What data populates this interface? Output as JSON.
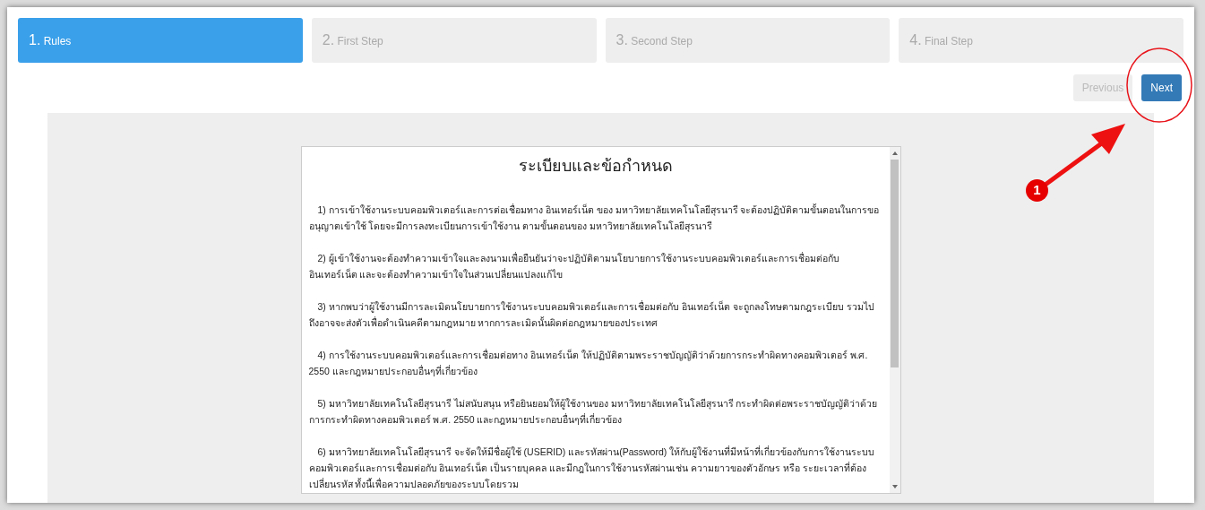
{
  "steps": [
    {
      "number": "1.",
      "label": "Rules",
      "selected": true
    },
    {
      "number": "2.",
      "label": "First Step",
      "selected": false
    },
    {
      "number": "3.",
      "label": "Second Step",
      "selected": false
    },
    {
      "number": "4.",
      "label": "Final Step",
      "selected": false
    }
  ],
  "buttons": [
    {
      "label": "Previous",
      "disabled": true
    },
    {
      "label": "Next",
      "disabled": false
    }
  ],
  "document": {
    "title": "ระเบียบและข้อกำหนด",
    "paragraphs": [
      "1) การเข้าใช้งานระบบคอมพิวเตอร์และการต่อเชื่อมทาง อินเทอร์เน็ต ของ มหาวิทยาลัยเทคโนโลยีสุรนารี จะต้องปฏิบัติตามขั้นตอนในการขออนุญาตเข้าใช้ โดยจะมีการลงทะเบียนการเข้าใช้งาน ตามขั้นตอนของ มหาวิทยาลัยเทคโนโลยีสุรนารี",
      "2) ผู้เข้าใช้งานจะต้องทำความเข้าใจและลงนามเพื่อยืนยันว่าจะปฏิบัติตามนโยบายการใช้งานระบบคอมพิวเตอร์และการเชื่อมต่อกับ อินเทอร์เน็ต และจะต้องทำความเข้าใจในส่วนเปลี่ยนแปลงแก้ไข",
      "3) หากพบว่าผู้ใช้งานมีการละเมิดนโยบายการใช้งานระบบคอมพิวเตอร์และการเชื่อมต่อกับ อินเทอร์เน็ต จะถูกลงโทษตามกฎระเบียบ รวมไปถึงอาจจะส่งตัวเพื่อดำเนินคดีตามกฎหมาย หากการละเมิดนั้นผิดต่อกฎหมายของประเทศ",
      "4) การใช้งานระบบคอมพิวเตอร์และการเชื่อมต่อทาง อินเทอร์เน็ต ให้ปฏิบัติตามพระราชบัญญัติว่าด้วยการกระทำผิดทางคอมพิวเตอร์ พ.ศ. 2550 และกฎหมายประกอบอื่นๆที่เกี่ยวข้อง",
      "5) มหาวิทยาลัยเทคโนโลยีสุรนารี ไม่สนับสนุน หรือยินยอมให้ผู้ใช้งานของ มหาวิทยาลัยเทคโนโลยีสุรนารี กระทำผิดต่อพระราชบัญญัติว่าด้วยการกระทำผิดทางคอมพิวเตอร์ พ.ศ. 2550 และกฎหมายประกอบอื่นๆที่เกี่ยวข้อง",
      "6) มหาวิทยาลัยเทคโนโลยีสุรนารี จะจัดให้มีชื่อผู้ใช้ (USERID) และรหัสผ่าน(Password) ให้กับผู้ใช้งานที่มีหน้าที่เกี่ยวข้องกับการใช้งานระบบคอมพิวเตอร์และการเชื่อมต่อกับ อินเทอร์เน็ต เป็นรายบุคคล และมีกฎในการใช้งานรหัสผ่านเช่น ความยาวของตัวอักษร หรือ ระยะเวลาที่ต้องเปลี่ยนรหัส ทั้งนี้เพื่อความปลอดภัยของระบบโดยรวม"
    ]
  },
  "annotation": {
    "badge": "1"
  }
}
